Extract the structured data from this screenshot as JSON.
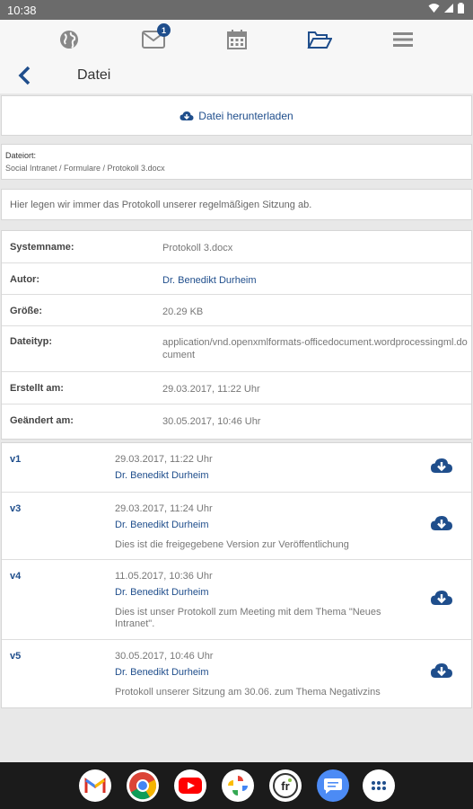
{
  "status": {
    "time": "10:38"
  },
  "nav": {
    "mail_badge": "1"
  },
  "header": {
    "title": "Datei"
  },
  "download": {
    "label": "Datei herunterladen"
  },
  "location": {
    "label": "Dateiort:",
    "path": "Social Intranet / Formulare / Protokoll 3.docx"
  },
  "description": "Hier legen wir immer das Protokoll unserer regelmäßigen Sitzung ab.",
  "properties": [
    {
      "key": "Systemname:",
      "value": "Protokoll 3.docx",
      "link": false
    },
    {
      "key": "Autor:",
      "value": "Dr. Benedikt Durheim",
      "link": true
    },
    {
      "key": "Größe:",
      "value": "20.29 KB",
      "link": false
    },
    {
      "key": "Dateityp:",
      "value": "application/vnd.openxmlformats-officedocument.wordprocessingml.document",
      "link": false
    },
    {
      "key": "Erstellt am:",
      "value": "29.03.2017, 11:22 Uhr",
      "link": false
    },
    {
      "key": "Geändert am:",
      "value": "30.05.2017, 10:46 Uhr",
      "link": false
    }
  ],
  "versions": [
    {
      "label": "v1",
      "date": "29.03.2017, 11:22 Uhr",
      "author": "Dr. Benedikt Durheim",
      "note": ""
    },
    {
      "label": "v3",
      "date": "29.03.2017, 11:24 Uhr",
      "author": "Dr. Benedikt Durheim",
      "note": "Dies ist die freigegebene Version zur Veröffentlichung"
    },
    {
      "label": "v4",
      "date": "11.05.2017, 10:36 Uhr",
      "author": "Dr. Benedikt Durheim",
      "note": "Dies ist unser Protokoll zum Meeting mit dem Thema \"Neues Intranet\"."
    },
    {
      "label": "v5",
      "date": "30.05.2017, 10:46 Uhr",
      "author": "Dr. Benedikt Durheim",
      "note": "Protokoll unserer Sitzung am 30.06. zum Thema Negativzins"
    }
  ],
  "dock": [
    {
      "name": "gmail-app",
      "icon": "gmail-icon"
    },
    {
      "name": "chrome-app",
      "icon": "chrome-icon"
    },
    {
      "name": "youtube-app",
      "icon": "youtube-icon"
    },
    {
      "name": "photos-app",
      "icon": "photos-icon"
    },
    {
      "name": "fr-app",
      "icon": "fr-icon"
    },
    {
      "name": "messages-app",
      "icon": "messages-icon"
    },
    {
      "name": "all-apps",
      "icon": "apps-grid-icon"
    }
  ]
}
